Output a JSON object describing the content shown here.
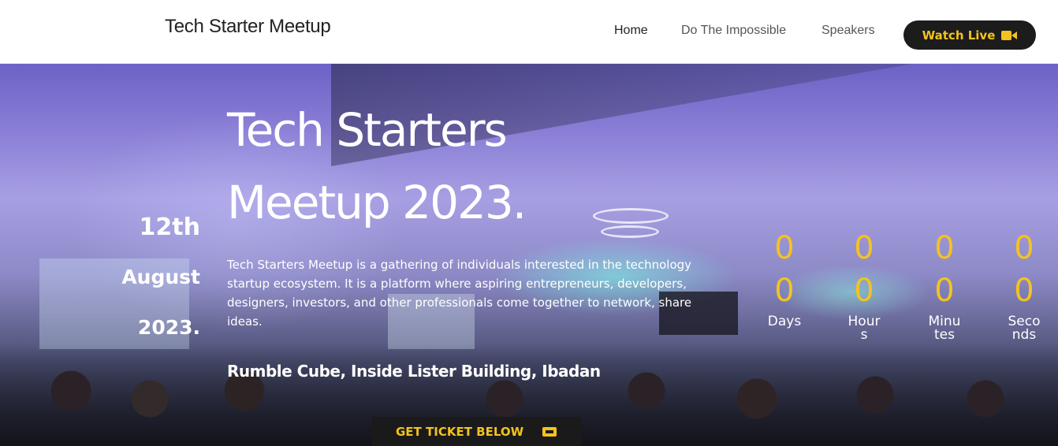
{
  "header": {
    "brand": "Tech Starter Meetup",
    "nav": [
      {
        "label": "Home"
      },
      {
        "label": "Do The Impossible"
      },
      {
        "label": "Speakers"
      }
    ],
    "watch_live": "Watch Live",
    "watch_icon": "video-camera-icon"
  },
  "hero": {
    "title": "Tech Starters Meetup 2023.",
    "date": {
      "day": "12th",
      "month": "August",
      "year": "2023."
    },
    "description": "Tech Starters Meetup is a gathering of individuals interested in the technology startup ecosystem. It is a platform where aspiring entrepreneurs, developers, designers, investors, and other professionals come together to network, share ideas.",
    "venue": "Rumble Cube, Inside Lister Building, Ibadan",
    "ticket_button": "GET TICKET BELOW",
    "ticket_icon": "ticket-icon"
  },
  "countdown": [
    {
      "value": "00",
      "label": "Days"
    },
    {
      "value": "00",
      "label": "Hours"
    },
    {
      "value": "00",
      "label": "Minutes"
    },
    {
      "value": "00",
      "label": "Seconds"
    }
  ],
  "colors": {
    "accent": "#f3c220",
    "button_bg": "#1c1c1c",
    "header_bg": "#ffffff"
  }
}
